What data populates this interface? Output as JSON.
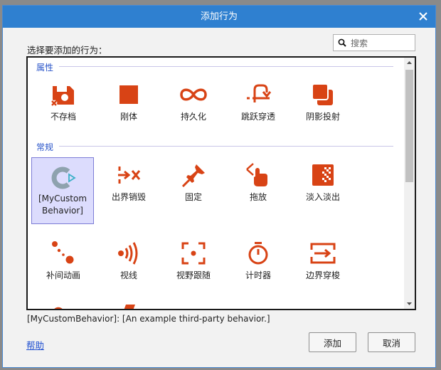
{
  "window": {
    "title": "添加行为"
  },
  "prompt": "选择要添加的行为：",
  "search": {
    "placeholder": "搜索",
    "value": ""
  },
  "sections": [
    {
      "label": "属性",
      "items": [
        {
          "label": "不存档",
          "icon": "no-save-icon"
        },
        {
          "label": "刚体",
          "icon": "solid-icon"
        },
        {
          "label": "持久化",
          "icon": "persist-icon"
        },
        {
          "label": "跳跃穿透",
          "icon": "jump-thru-icon"
        },
        {
          "label": "阴影投射",
          "icon": "shadow-caster-icon"
        }
      ]
    },
    {
      "label": "常规",
      "items": [
        {
          "label": "[MyCustom Behavior]",
          "icon": "custom-behavior-icon",
          "selected": true
        },
        {
          "label": "出界销毁",
          "icon": "destroy-outside-icon"
        },
        {
          "label": "固定",
          "icon": "pin-icon"
        },
        {
          "label": "拖放",
          "icon": "drag-drop-icon"
        },
        {
          "label": "淡入淡出",
          "icon": "fade-icon"
        },
        {
          "label": "补间动画",
          "icon": "tween-icon"
        },
        {
          "label": "视线",
          "icon": "line-of-sight-icon"
        },
        {
          "label": "视野跟随",
          "icon": "scroll-to-icon"
        },
        {
          "label": "计时器",
          "icon": "timer-icon"
        },
        {
          "label": "边界穿梭",
          "icon": "wrap-icon"
        }
      ]
    }
  ],
  "description": "[MyCustomBehavior]: [An example third-party behavior.]",
  "buttons": {
    "help": "帮助",
    "add": "添加",
    "cancel": "取消"
  },
  "colors": {
    "accent": "#d84315",
    "titlebar": "#2f80d0",
    "selection": "#dcdcfd"
  }
}
